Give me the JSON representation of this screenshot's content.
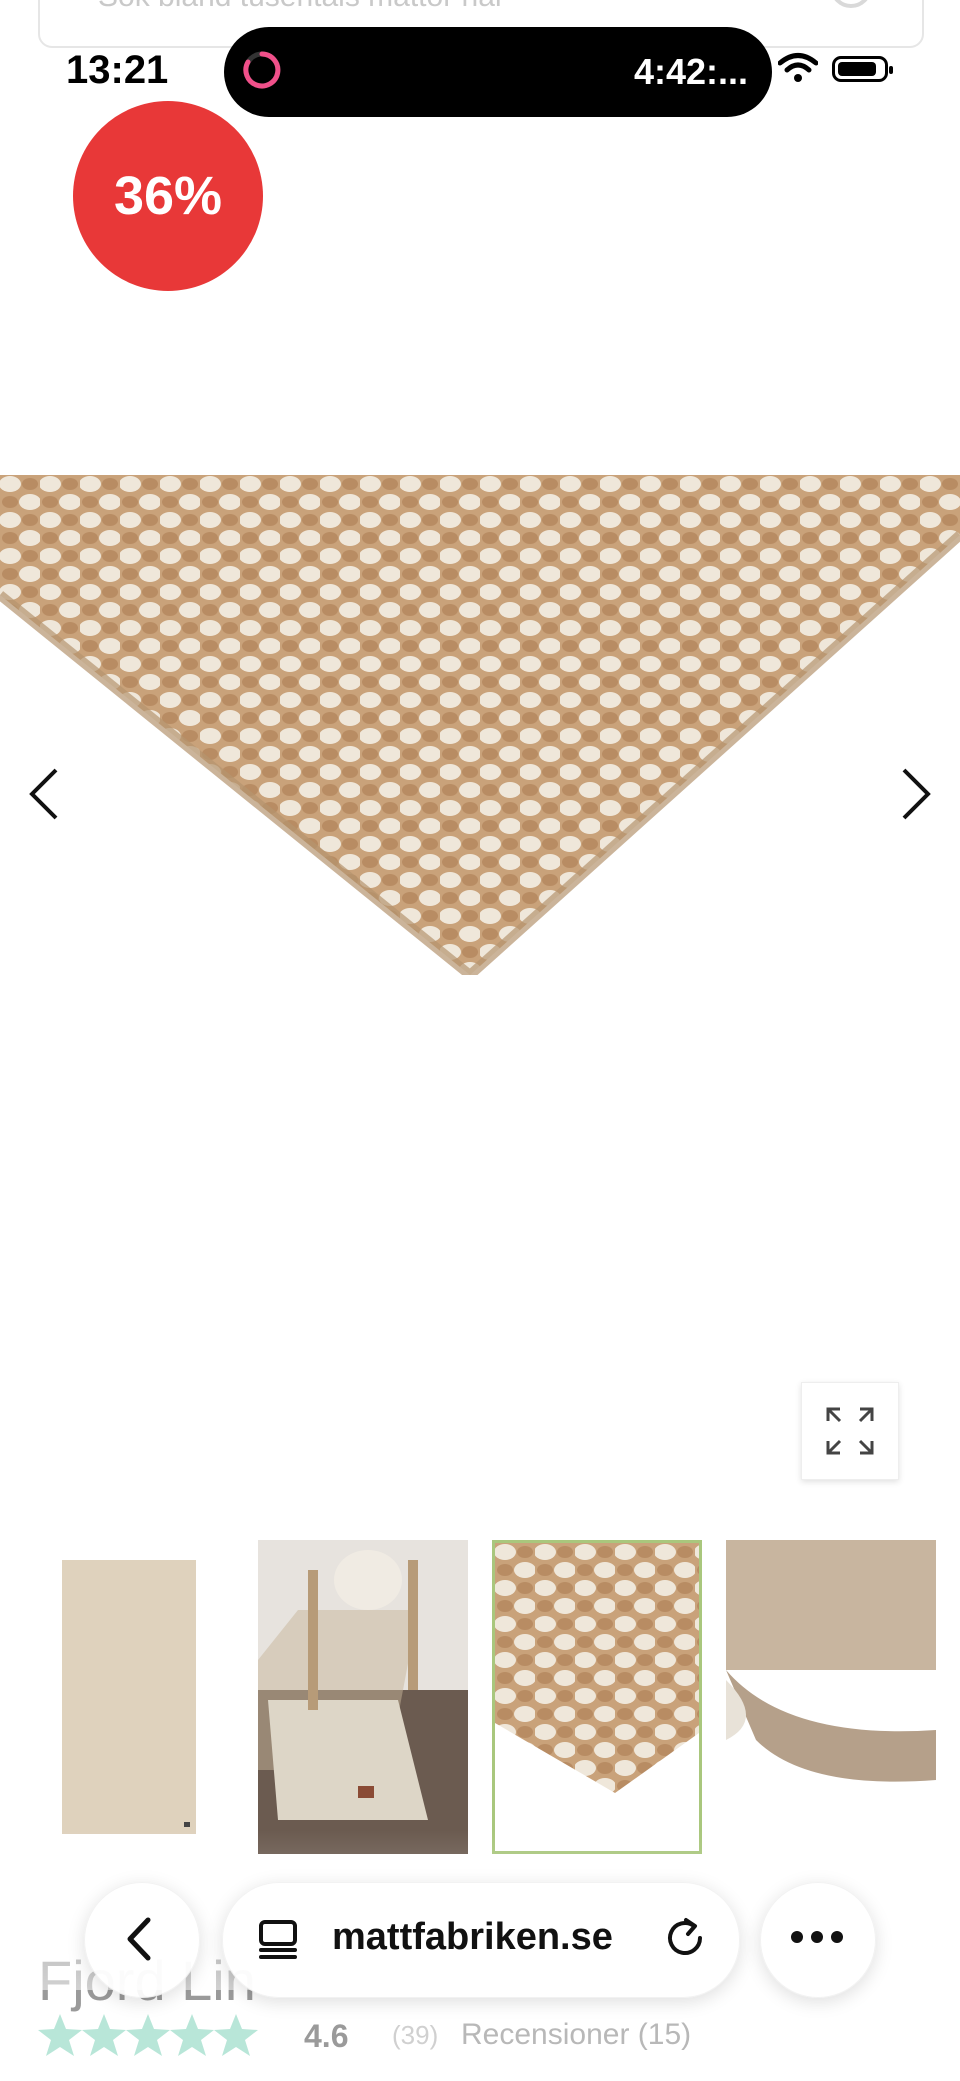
{
  "search": {
    "placeholder": "Sök bland tusentals mattor här"
  },
  "status_bar": {
    "time": "13:21",
    "island_timer": "4:42:..."
  },
  "product": {
    "discount_badge": "36%",
    "title": "Fjord Lin",
    "rating": "4.6",
    "rating_count": "(39)",
    "reviews_link": "Recensioner (15)"
  },
  "gallery": {
    "thumbnail_count": 4,
    "selected_index": 2
  },
  "browser": {
    "url": "mattfabriken.se"
  },
  "colors": {
    "badge": "#e83838",
    "selected_thumb_border": "#a9c77d",
    "star": "#b8e6d8"
  }
}
